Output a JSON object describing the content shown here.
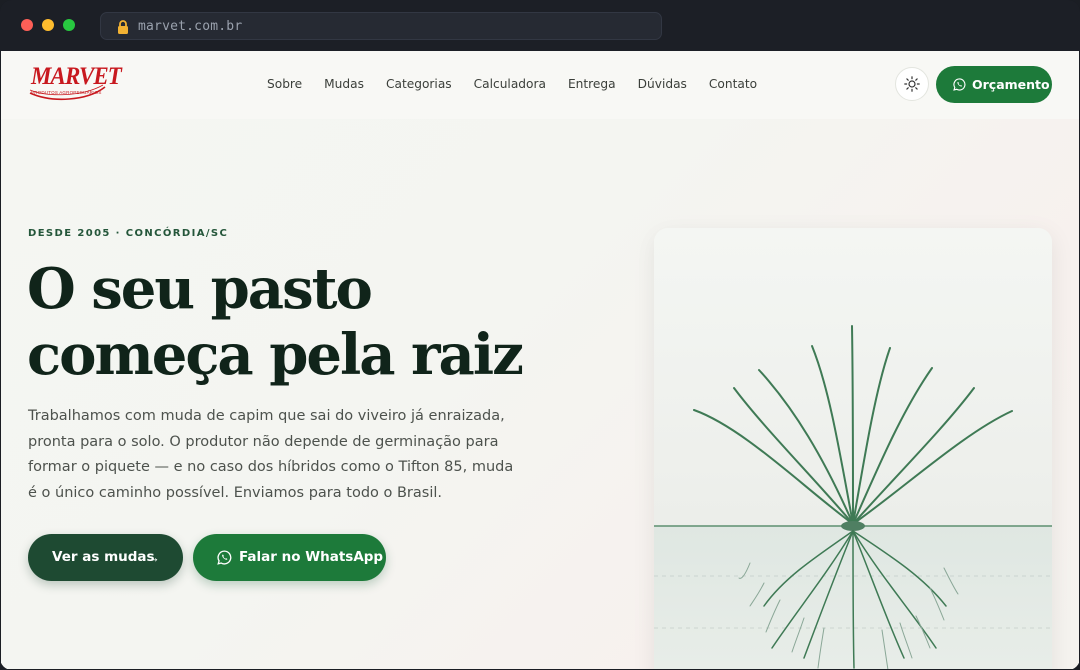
{
  "browser": {
    "url": "marvet.com.br"
  },
  "nav": {
    "logo_text": "MARVET",
    "logo_subtitle": "PRODUTOS AGROPECUÁRIOS",
    "links": [
      "Sobre",
      "Mudas",
      "Categorias",
      "Calculadora",
      "Entrega",
      "Dúvidas",
      "Contato"
    ],
    "cta_label": "Orçamento"
  },
  "hero": {
    "eyebrow": "DESDE 2005 · CONCÓRDIA/SC",
    "title_line1": "O seu pasto",
    "title_line2": "começa pela raiz",
    "lead": "Trabalhamos com muda de capim que sai do viveiro já enraizada, pronta para o solo. O produtor não depende de germinação para formar o piquete — e no caso dos híbridos como o Tifton 85, muda é o único caminho possível. Enviamos para todo o Brasil.",
    "primary_label": "Ver as mudas",
    "primary_arrow": "→",
    "whatsapp_label": "Falar no WhatsApp"
  },
  "colors": {
    "brand_green": "#1d7a3a",
    "dark_green": "#1e4a32",
    "logo_red": "#c8191f",
    "headline": "#10241a"
  },
  "icons": [
    "lock-icon",
    "sun-icon",
    "whatsapp-icon",
    "arrow-right-icon",
    "grass-plant-illustration"
  ]
}
